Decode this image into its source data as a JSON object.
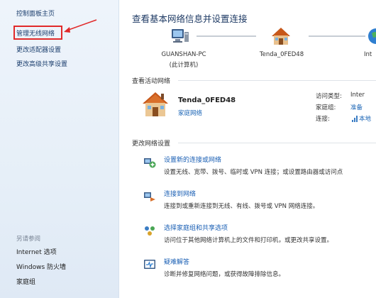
{
  "sidebar": {
    "home": "控制面板主页",
    "wireless": "管理无线网络",
    "adapter": "更改适配器设置",
    "sharing": "更改高级共享设置",
    "see_also": "另请参阅",
    "links": [
      "Internet 选项",
      "Windows 防火墙",
      "家庭组"
    ]
  },
  "main": {
    "title": "查看基本网络信息并设置连接",
    "map": {
      "computer": "GUANSHAN-PC",
      "computer_sub": "(此计算机)",
      "network": "Tenda_0FED48",
      "internet_partial": "Int"
    },
    "active_label": "查看活动网络",
    "active": {
      "name": "Tenda_0FED48",
      "type": "家庭网络",
      "access_label": "访问类型:",
      "access_value": "Inter",
      "homegroup_label": "家庭组:",
      "homegroup_value": "准备",
      "connection_label": "连接:",
      "connection_value": "本地"
    },
    "change_label": "更改网络设置",
    "tasks": [
      {
        "link": "设置新的连接或网络",
        "desc": "设置无线、宽带、拨号、临时或 VPN 连接；或设置路由器或访问点"
      },
      {
        "link": "连接到网络",
        "desc": "连接到或重新连接到无线、有线、拨号或 VPN 网络连接。"
      },
      {
        "link": "选择家庭组和共享选项",
        "desc": "访问位于其他网络计算机上的文件和打印机，或更改共享设置。"
      },
      {
        "link": "疑难解答",
        "desc": "诊断并修复网络问题，或获得故障排除信息。"
      }
    ]
  },
  "colors": {
    "link": "#1a5fb4",
    "title": "#1e3a64",
    "highlight_box": "#e12a2a",
    "sidebar_bg": "#e6eff8"
  }
}
